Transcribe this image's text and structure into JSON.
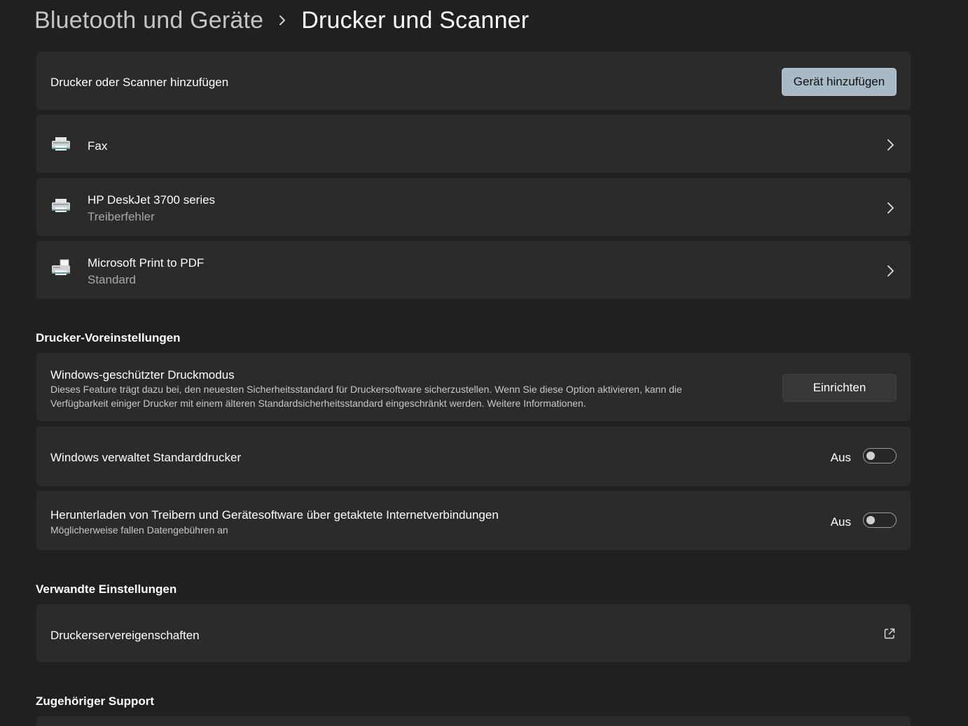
{
  "breadcrumb": {
    "parent": "Bluetooth und Geräte",
    "separator_icon": "chevron-right-icon",
    "current": "Drucker und Scanner"
  },
  "add_device": {
    "label": "Drucker oder Scanner hinzufügen",
    "button_label": "Gerät hinzufügen",
    "button_color": "#a9bac7"
  },
  "printers": [
    {
      "name": "Fax",
      "status": "",
      "icon": "fax-printer-icon"
    },
    {
      "name": "HP DeskJet 3700 series",
      "status": "Treiberfehler",
      "icon": "printer-icon"
    },
    {
      "name": "Microsoft Print to PDF",
      "status": "Standard",
      "icon": "pdf-printer-icon"
    }
  ],
  "printer_settings": {
    "title": "Drucker-Voreinstellungen",
    "protected_mode": {
      "title": "Windows-geschützter Druckmodus",
      "description_line1": "Dieses Feature trägt dazu bei, den neuesten Sicherheitsstandard für Druckersoftware sicherzustellen. Wenn Sie diese Option aktivieren, kann die",
      "description_line2": "Verfügbarkeit einiger Drucker mit einem älteren Standardsicherheitsstandard eingeschränkt werden. Weitere Informationen.",
      "button_label": "Einrichten"
    },
    "default_printer": {
      "label": "Windows verwaltet Standarddrucker",
      "state_label": "Aus",
      "enabled": false
    },
    "metered_download": {
      "label": "Herunterladen von Treibern und Gerätesoftware über getaktete Internetverbindungen",
      "sublabel": "Möglicherweise fallen Datengebühren an",
      "state_label": "Aus",
      "enabled": false
    }
  },
  "related_settings": {
    "title": "Verwandte Einstellungen",
    "items": [
      {
        "label": "Druckerservereigenschaften",
        "icon": "external-link-icon"
      }
    ]
  },
  "support": {
    "title": "Zugehöriger Support"
  },
  "colors": {
    "background": "#202020",
    "card": "#2b2b2b",
    "secondary_text": "#a8a8a8"
  }
}
